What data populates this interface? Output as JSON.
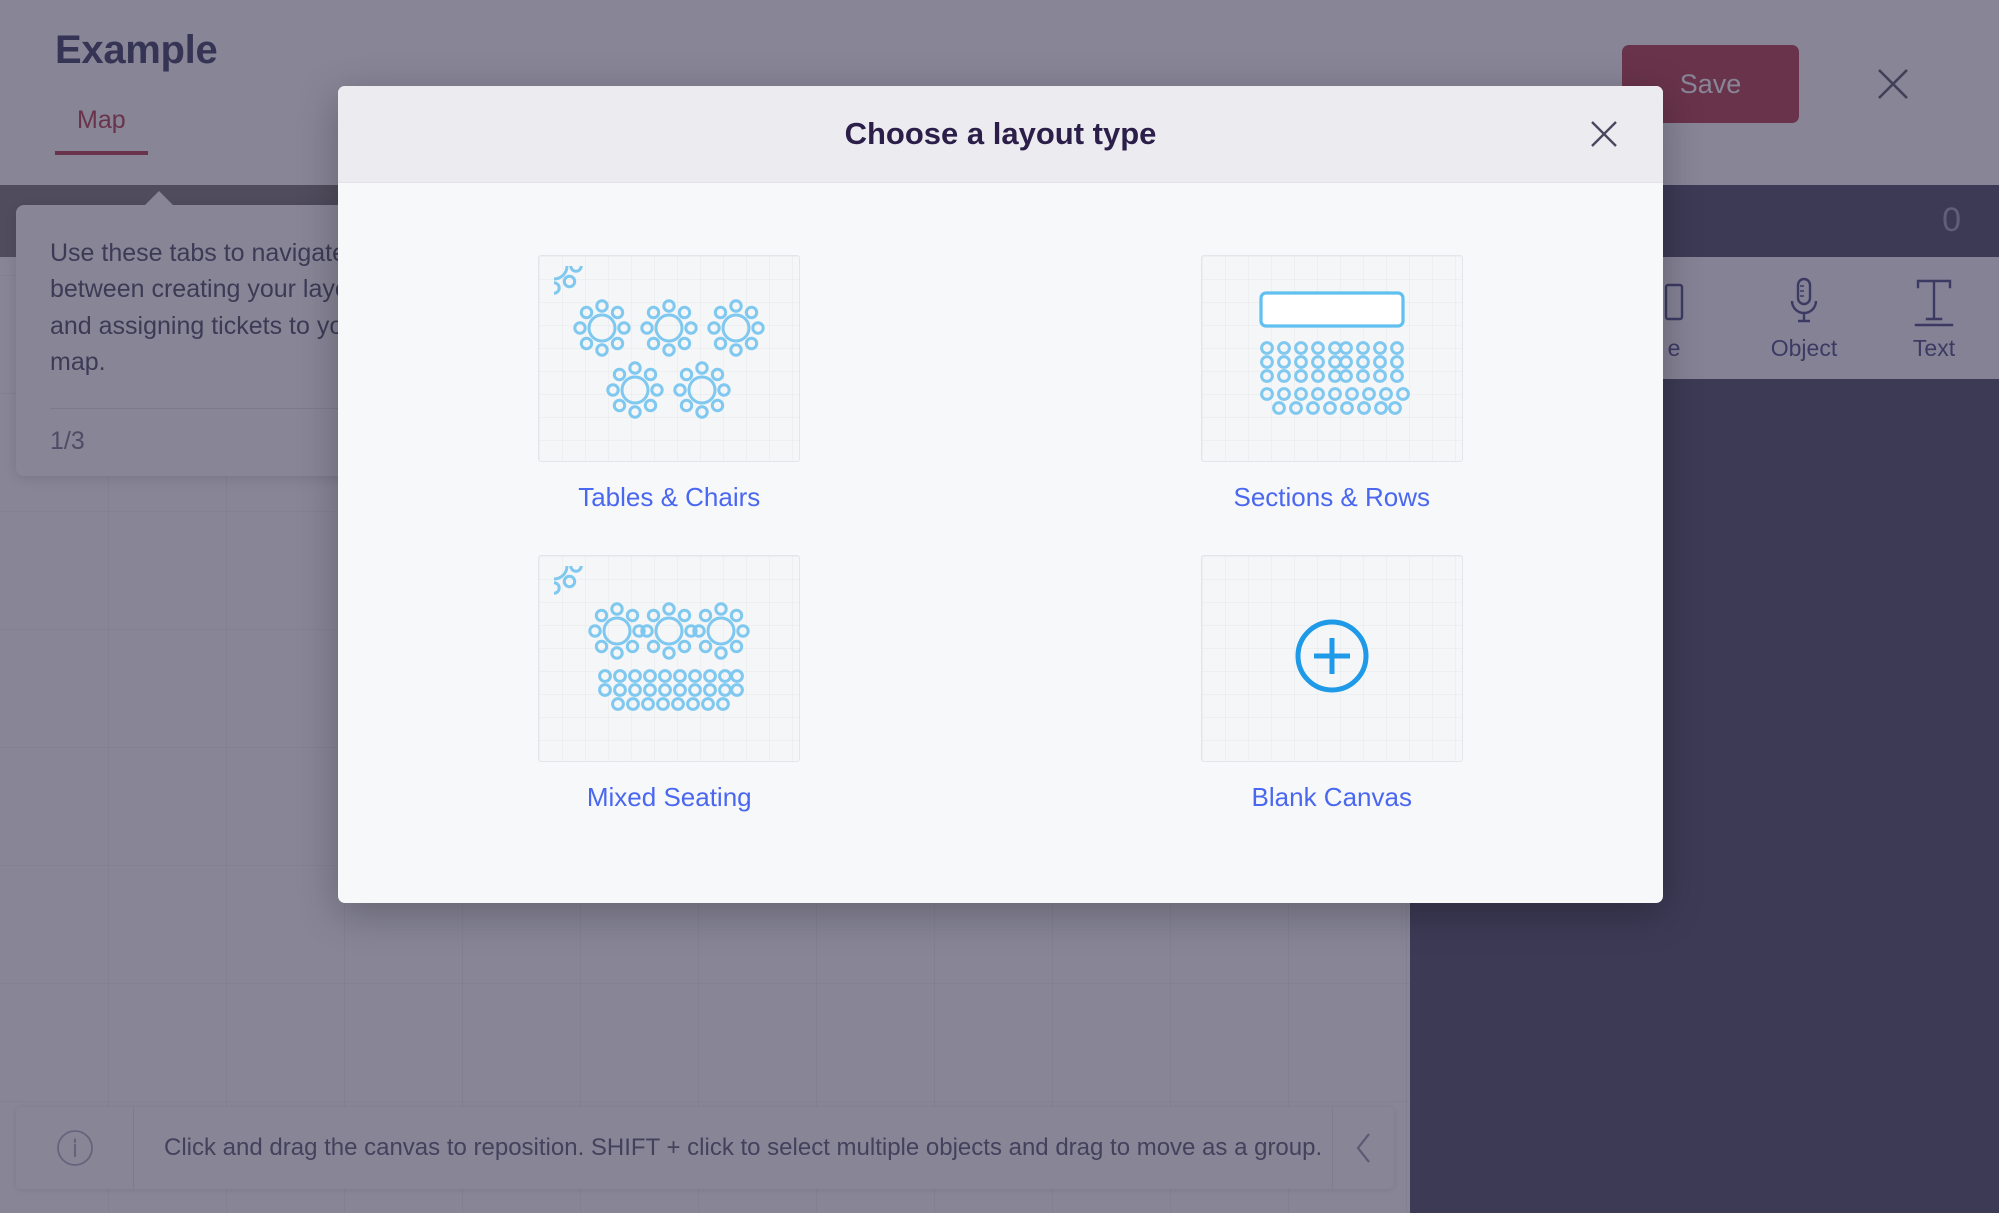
{
  "app": {
    "title": "Example",
    "tabs": [
      {
        "label": "Map",
        "active": true
      }
    ],
    "save_label": "Save",
    "close_icon": "close-icon",
    "object_count": "0",
    "tools": [
      {
        "icon": "image-icon",
        "label": "e"
      },
      {
        "icon": "microphone-icon",
        "label": "Object"
      },
      {
        "icon": "text-icon",
        "label": "Text"
      }
    ],
    "coachmark": {
      "text": "Use these tabs to navigate between creating your layout and assigning tickets to your map.",
      "page": "1/3"
    },
    "status_bar": {
      "info_icon": "info-icon",
      "message": "Click and drag the canvas to reposition. SHIFT + click to select multiple objects and drag to move as a group.",
      "chevron_icon": "chevron-left-icon"
    }
  },
  "modal": {
    "title": "Choose a layout type",
    "close_icon": "close-icon",
    "options": [
      {
        "id": "tables-chairs",
        "label": "Tables & Chairs",
        "thumb": "tables-and-chairs-diagram"
      },
      {
        "id": "sections-rows",
        "label": "Sections & Rows",
        "thumb": "sections-and-rows-diagram"
      },
      {
        "id": "mixed-seating",
        "label": "Mixed Seating",
        "thumb": "mixed-seating-diagram"
      },
      {
        "id": "blank-canvas",
        "label": "Blank Canvas",
        "thumb": "plus-circle-icon"
      }
    ]
  },
  "colors": {
    "accent_blue": "#4a67f0",
    "icon_blue": "#7fc8ef",
    "plus_blue": "#1e9ae8",
    "brand_red": "#b0293a",
    "overlay": "#3d3a55",
    "panel_dark": "#3b3a55"
  }
}
